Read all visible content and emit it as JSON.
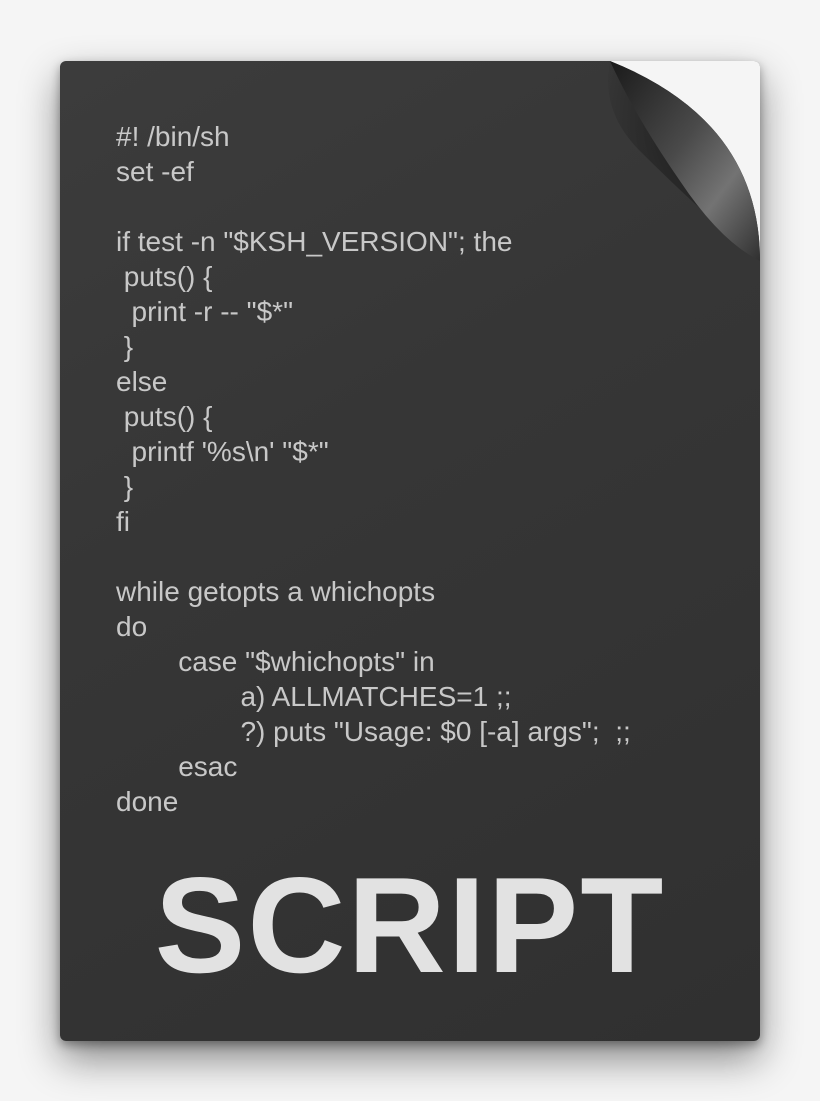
{
  "code_lines": [
    "#! /bin/sh",
    "set -ef",
    "",
    "if test -n \"$KSH_VERSION\"; the",
    " puts() {",
    "  print -r -- \"$*\"",
    " }",
    "else",
    " puts() {",
    "  printf '%s\\n' \"$*\"",
    " }",
    "fi",
    "",
    "while getopts a whichopts",
    "do",
    "        case \"$whichopts\" in",
    "                a) ALLMATCHES=1 ;;",
    "                ?) puts \"Usage: $0 [-a] args\";  ;;",
    "        esac",
    "done"
  ],
  "label": "SCRIPT"
}
